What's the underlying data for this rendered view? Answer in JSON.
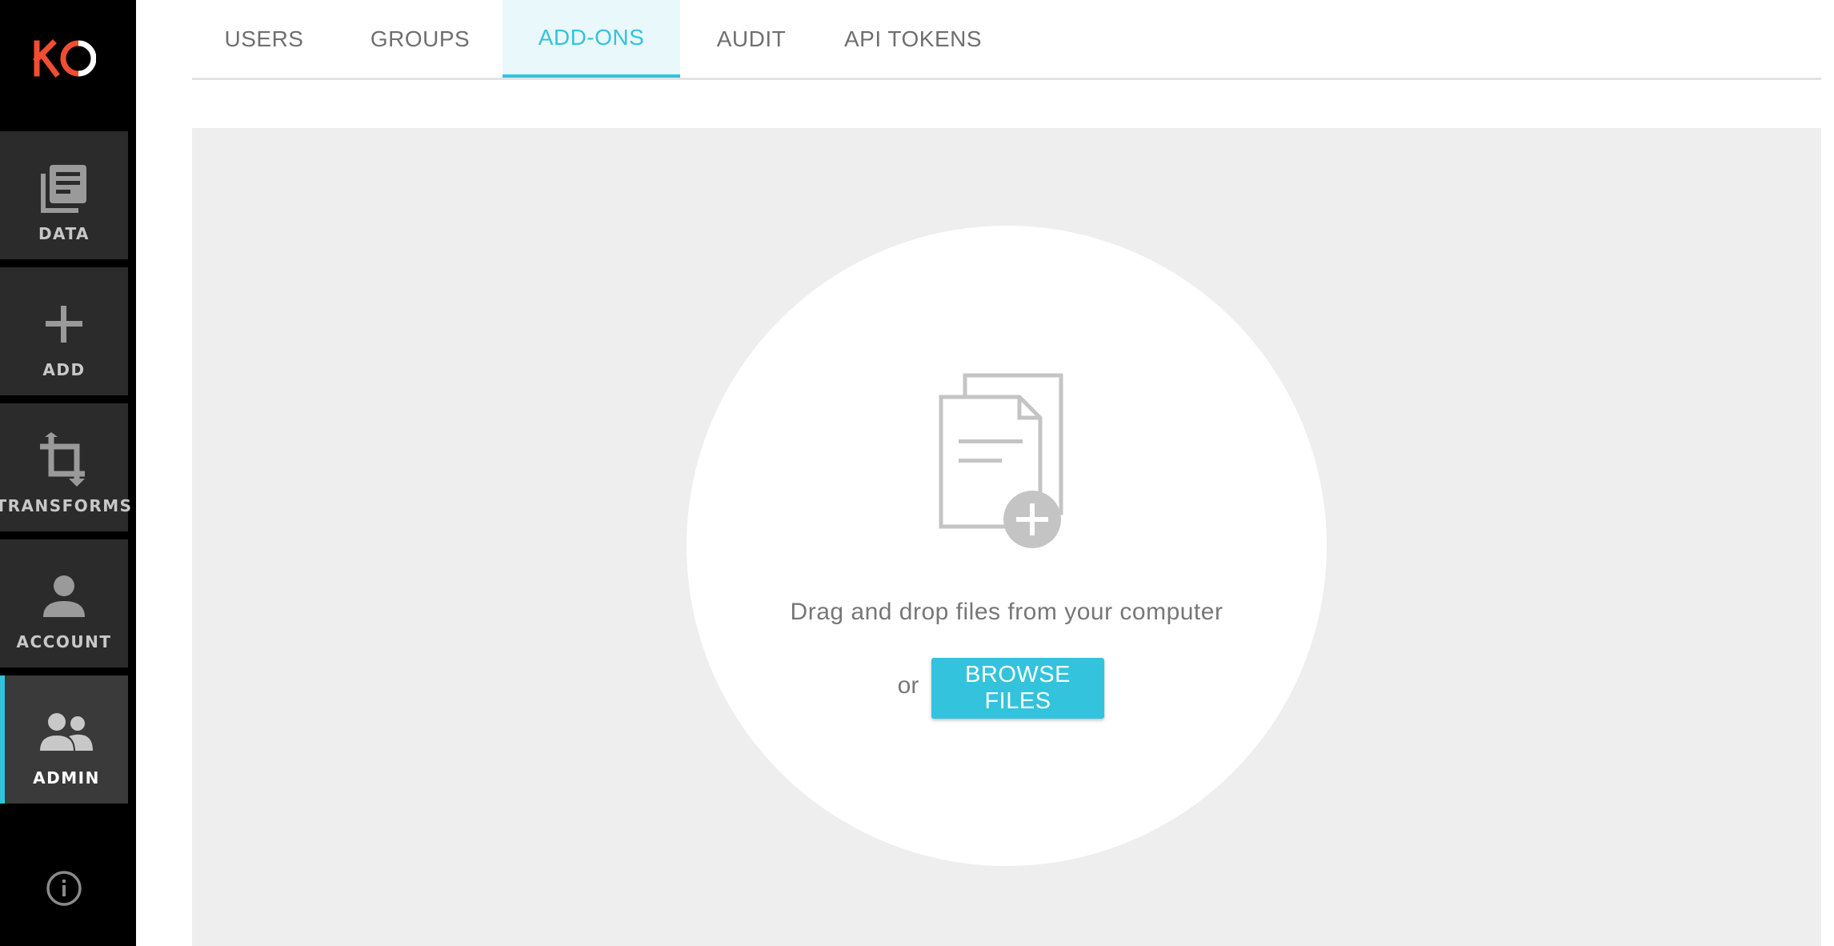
{
  "brand": {
    "logo_text": "KO",
    "accent_color": "#33c3dc",
    "logo_color": "#f04e30"
  },
  "sidebar": {
    "items": [
      {
        "label": "DATA",
        "icon": "data-icon",
        "active": false
      },
      {
        "label": "ADD",
        "icon": "plus-icon",
        "active": false
      },
      {
        "label": "TRANSFORMS",
        "icon": "crop-icon",
        "active": false
      },
      {
        "label": "ACCOUNT",
        "icon": "person-icon",
        "active": false
      },
      {
        "label": "ADMIN",
        "icon": "people-icon",
        "active": true
      }
    ],
    "info_icon": "info-icon"
  },
  "tabs": [
    {
      "label": "USERS",
      "active": false
    },
    {
      "label": "GROUPS",
      "active": false
    },
    {
      "label": "ADD-ONS",
      "active": true
    },
    {
      "label": "AUDIT",
      "active": false
    },
    {
      "label": "API TOKENS",
      "active": false
    }
  ],
  "upload": {
    "icon": "file-add-icon",
    "drop_text": "Drag and drop files from your computer",
    "or_text": "or",
    "browse_label": "BROWSE FILES"
  }
}
